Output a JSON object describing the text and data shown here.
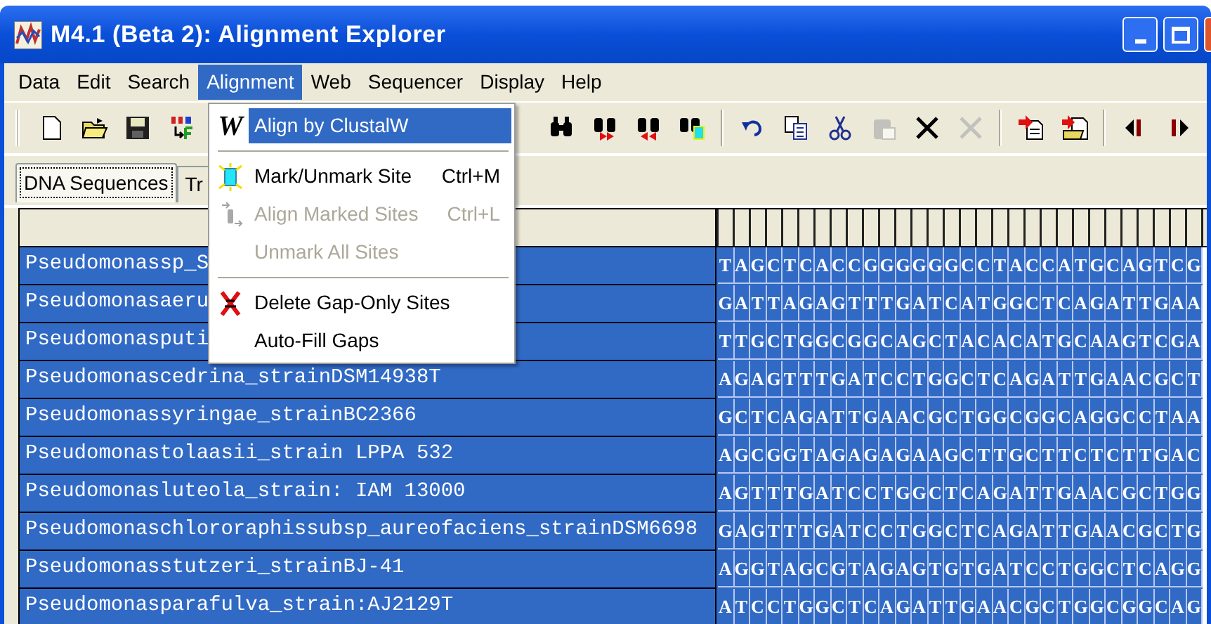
{
  "window": {
    "title": "M4.1 (Beta 2): Alignment Explorer"
  },
  "menu_bar": [
    {
      "label": "Data",
      "selected": false
    },
    {
      "label": "Edit",
      "selected": false
    },
    {
      "label": "Search",
      "selected": false
    },
    {
      "label": "Alignment",
      "selected": true
    },
    {
      "label": "Web",
      "selected": false
    },
    {
      "label": "Sequencer",
      "selected": false
    },
    {
      "label": "Display",
      "selected": false
    },
    {
      "label": "Help",
      "selected": false
    }
  ],
  "toolbar": [
    {
      "kind": "new",
      "disabled": false
    },
    {
      "kind": "open",
      "disabled": false
    },
    {
      "kind": "save",
      "disabled": false
    },
    {
      "kind": "translate",
      "disabled": false
    },
    {
      "kind": "gap"
    },
    {
      "kind": "find",
      "disabled": false
    },
    {
      "kind": "find-next",
      "disabled": false
    },
    {
      "kind": "find-prev",
      "disabled": false
    },
    {
      "kind": "find-mark",
      "disabled": false
    },
    {
      "kind": "sep"
    },
    {
      "kind": "undo",
      "disabled": false
    },
    {
      "kind": "copy",
      "disabled": false
    },
    {
      "kind": "cut",
      "disabled": false
    },
    {
      "kind": "paste",
      "disabled": true
    },
    {
      "kind": "delete",
      "disabled": false
    },
    {
      "kind": "delete",
      "disabled": true
    },
    {
      "kind": "sep"
    },
    {
      "kind": "import",
      "disabled": false
    },
    {
      "kind": "import-folder",
      "disabled": false
    },
    {
      "kind": "sep"
    },
    {
      "kind": "prev",
      "disabled": false
    },
    {
      "kind": "next",
      "disabled": false
    }
  ],
  "dropdown_menu": [
    {
      "kind": "item",
      "icon_text": "W",
      "label": "Align by ClustalW",
      "selected": true,
      "disabled": false
    },
    {
      "kind": "separator"
    },
    {
      "kind": "item",
      "label": "Mark/Unmark Site",
      "shortcut": "Ctrl+M",
      "selected": false,
      "disabled": false
    },
    {
      "kind": "item",
      "label": "Align Marked Sites",
      "shortcut": "Ctrl+L",
      "selected": false,
      "disabled": true
    },
    {
      "kind": "item",
      "label": "Unmark All Sites",
      "selected": false,
      "disabled": true
    },
    {
      "kind": "separator"
    },
    {
      "kind": "item",
      "label": "Delete Gap-Only Sites",
      "selected": false,
      "disabled": false
    },
    {
      "kind": "item",
      "label": "Auto-Fill Gaps",
      "selected": false,
      "disabled": false
    }
  ],
  "tabs": [
    {
      "label": "DNA Sequences",
      "selected": true
    },
    {
      "label": "Tr",
      "selected": false
    }
  ],
  "sequences": [
    {
      "name": "Pseudomonassp_S",
      "bases": "TAGCTCACCGGGGGGCCTACCATGCAGTCG",
      "selected": true
    },
    {
      "name": "Pseudomonasaeru",
      "bases": "GATTAGAGTTTGATCATGGCTCAGATTGAA",
      "selected": true
    },
    {
      "name": "Pseudomonasputi",
      "bases": "TTGCTGGCGGCAGCTACACATGCAAGTCGA",
      "selected": true
    },
    {
      "name": "Pseudomonascedrina_strainDSM14938T",
      "bases": "AGAGTTTGATCCTGGCTCAGATTGAACGCT",
      "selected": true
    },
    {
      "name": "Pseudomonassyringae_strainBC2366",
      "bases": "GCTCAGATTGAACGCTGGCGGCAGGCCTAA",
      "selected": true
    },
    {
      "name": "Pseudomonastolaasii_strain LPPA 532",
      "bases": "AGCGGTAGAGAGAAGCTTGCTTCTCTTGAC",
      "selected": true
    },
    {
      "name": "Pseudomonasluteola_strain: IAM 13000",
      "bases": "AGTTTGATCCTGGCTCAGATTGAACGCTGG",
      "selected": true
    },
    {
      "name": "Pseudomonaschlororaphissubsp_aureofaciens_strainDSM6698",
      "bases": "GAGTTTGATCCTGGCTCAGATTGAACGCTG",
      "selected": true
    },
    {
      "name": "Pseudomonasstutzeri_strainBJ-41",
      "bases": "AGGTAGCGTAGAGTGTGATCCTGGCTCAGG",
      "selected": true
    },
    {
      "name": "Pseudomonasparafulva_strain:AJ2129T",
      "bases": "ATCCTGGCTCAGATTGAACGCTGGCGGCAG",
      "selected": true
    }
  ]
}
